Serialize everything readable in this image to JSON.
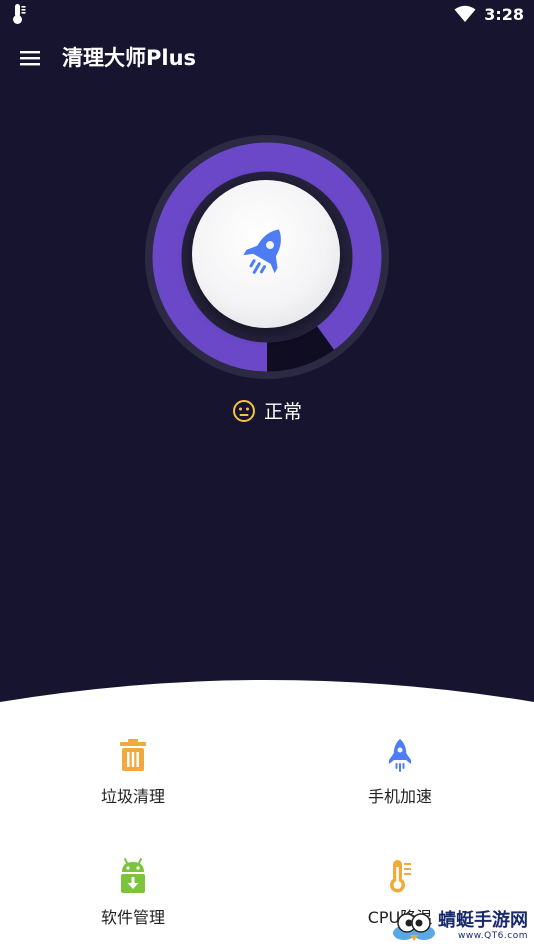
{
  "status_bar": {
    "time": "3:28",
    "left_icon": "thermometer-icon",
    "wifi_icon": "wifi-icon"
  },
  "app_bar": {
    "menu_icon": "menu-icon",
    "title": "清理大师Plus"
  },
  "gauge": {
    "fill_percent": 90,
    "center_icon": "rocket-icon",
    "colors": {
      "outer_track": "#2c2943",
      "fill": "#6a48c8",
      "remainder": "#100d22",
      "button": "#f4f4f6",
      "rocket": "#4d7cf5"
    }
  },
  "status": {
    "icon": "neutral-face-icon",
    "text": "正常",
    "icon_color": "#f5c342"
  },
  "features": [
    {
      "icon": "trash-icon",
      "label": "垃圾清理",
      "color": "#f2a93b"
    },
    {
      "icon": "rocket-icon",
      "label": "手机加速",
      "color": "#4d7cf5"
    },
    {
      "icon": "android-download-icon",
      "label": "软件管理",
      "color": "#7cc43c"
    },
    {
      "icon": "thermometer-icon",
      "label": "CPU降温",
      "color": "#f2a93b"
    }
  ],
  "watermark": {
    "title": "蜻蜓手游网",
    "url": "www.QT6.com"
  },
  "colors": {
    "background": "#17142f",
    "panel": "#ffffff"
  }
}
